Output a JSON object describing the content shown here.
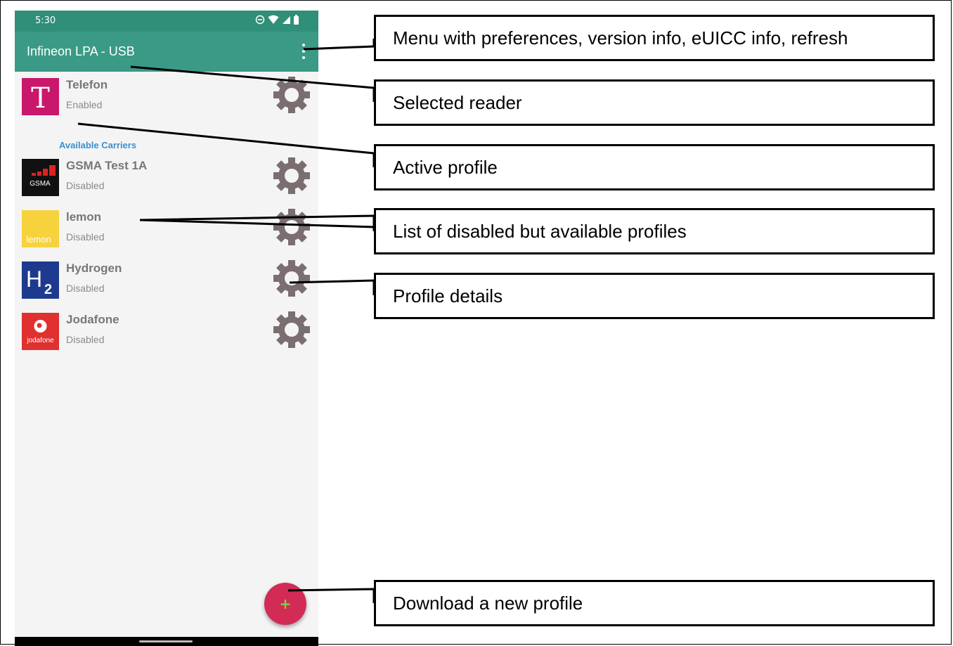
{
  "status_bar": {
    "time": "5:30"
  },
  "app_bar": {
    "title": "Infineon LPA - USB"
  },
  "active_profile": {
    "name": "Telefon",
    "status": "Enabled",
    "logo_text": "T",
    "logo_color": "#c9186c"
  },
  "section": {
    "label": "Available Carriers"
  },
  "profiles": [
    {
      "name": "GSMA Test 1A",
      "status": "Disabled",
      "logo_text": "GSMA"
    },
    {
      "name": "lemon",
      "status": "Disabled",
      "logo_text": "lemon",
      "logo_color": "#f6d33c"
    },
    {
      "name": "Hydrogen",
      "status": "Disabled",
      "logo_text": "H",
      "logo_sub": "2",
      "logo_color": "#1d3a8e"
    },
    {
      "name": "Jodafone",
      "status": "Disabled",
      "logo_text": "jodafone",
      "logo_color": "#e03030"
    }
  ],
  "fab": {
    "label": "+",
    "color": "#d22c56"
  },
  "callouts": [
    "Menu with preferences, version info, eUICC info, refresh",
    "Selected reader",
    "Active profile",
    "List of disabled but available profiles",
    "Profile details",
    "Download a new profile"
  ],
  "colors": {
    "app_bar": "#3a9a86",
    "status_bar": "#2f8f79",
    "gear": "#7a6e70",
    "accent_label": "#3a8fd0"
  },
  "icons": [
    "overflow-menu-icon",
    "gear-icon",
    "plus-icon",
    "wifi-icon",
    "signal-icon",
    "battery-icon",
    "dnd-icon"
  ]
}
